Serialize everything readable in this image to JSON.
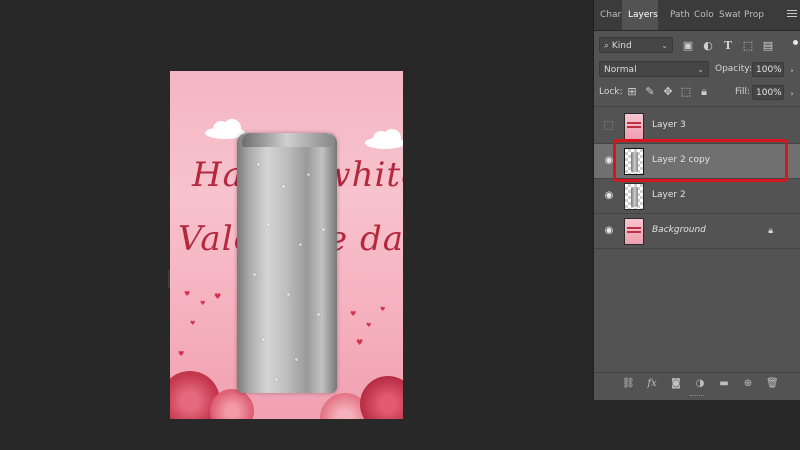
{
  "document": {
    "script_line1": "Happy white",
    "script_line2": "Valentine day"
  },
  "panel": {
    "tabs": [
      {
        "label": "Char",
        "active": false
      },
      {
        "label": "Layers",
        "active": true
      },
      {
        "label": "Path",
        "active": false
      },
      {
        "label": "Colo",
        "active": false
      },
      {
        "label": "Swat",
        "active": false
      },
      {
        "label": "Prop",
        "active": false
      }
    ],
    "filter": {
      "label": "Kind"
    },
    "blend_mode": "Normal",
    "opacity": {
      "label": "Opacity:",
      "value": "100%"
    },
    "lock": {
      "label": "Lock:"
    },
    "fill": {
      "label": "Fill:",
      "value": "100%"
    },
    "layers": [
      {
        "name": "Layer 3",
        "visible": false,
        "selected": false,
        "thumb": "pink",
        "locked": false
      },
      {
        "name": "Layer 2 copy",
        "visible": true,
        "selected": true,
        "thumb": "can",
        "locked": false
      },
      {
        "name": "Layer 2",
        "visible": true,
        "selected": false,
        "thumb": "can",
        "locked": false
      },
      {
        "name": "Background",
        "visible": true,
        "selected": false,
        "thumb": "pink",
        "locked": true
      }
    ],
    "bottom_icons": [
      "link-icon",
      "fx-icon",
      "mask-icon",
      "adjustment-icon",
      "group-folder-icon",
      "new-layer-icon",
      "trash-icon"
    ],
    "bottom_fx_label": "fx"
  },
  "colors": {
    "app_bg": "#282828",
    "panel_bg": "#535353",
    "selected_layer": "#707070",
    "highlight": "#d8141d"
  }
}
